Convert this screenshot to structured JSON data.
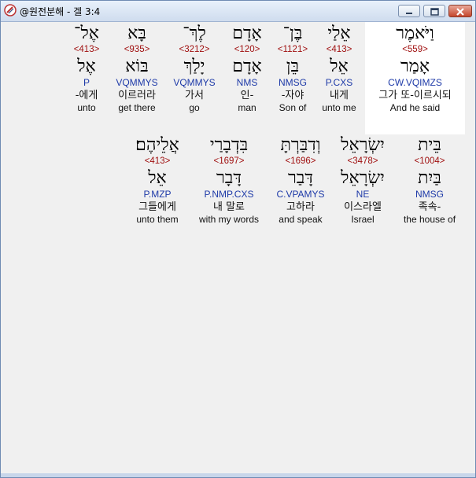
{
  "window": {
    "title": "@원전분해 - 겔 3:4",
    "icons": {
      "app": "bible-app-icon",
      "minimize": "minimize-icon",
      "maximize": "maximize-icon",
      "close": "close-icon"
    }
  },
  "rows": [
    [
      {
        "surface": "אֶל־",
        "strong": "<413>",
        "lemma": "אֶל",
        "parse": "P",
        "korean": "-에게",
        "english": "unto"
      },
      {
        "surface": "בָּא",
        "strong": "<935>",
        "lemma": "בּוֹא",
        "parse": "VQMMYS",
        "korean": "이르러라",
        "english": "get there"
      },
      {
        "surface": "לֶךְ־",
        "strong": "<3212>",
        "lemma": "יָלַךְ",
        "parse": "VQMMYS",
        "korean": "가서",
        "english": "go"
      },
      {
        "surface": "אָדָם",
        "strong": "<120>",
        "lemma": "אָדָם",
        "parse": "NMS",
        "korean": "인-",
        "english": "man"
      },
      {
        "surface": "בֶּן־",
        "strong": "<1121>",
        "lemma": "בֵּן",
        "parse": "NMSG",
        "korean": "-자야",
        "english": "Son of"
      },
      {
        "surface": "אֵלַי",
        "strong": "<413>",
        "lemma": "אֵל",
        "parse": "P.CXS",
        "korean": "내게",
        "english": "unto me"
      },
      {
        "surface": "וַיֹּאמֶר",
        "strong": "<559>",
        "lemma": "אָמַר",
        "parse": "CW.VQIMZS",
        "korean": "그가 또-이르시되",
        "english": "And he said",
        "highlighted": true
      }
    ],
    [
      {
        "surface": "אֲלֵיהֶם׃",
        "strong": "<413>",
        "lemma": "אֵל",
        "parse": "P.MZP",
        "korean": "그들에게",
        "english": "unto them"
      },
      {
        "surface": "בִּדְבָרַי",
        "strong": "<1697>",
        "lemma": "דָּבָר",
        "parse": "P.NMP.CXS",
        "korean": "내 말로",
        "english": "with my words"
      },
      {
        "surface": "וְדִבַּרְתָּ",
        "strong": "<1696>",
        "lemma": "דָּבַר",
        "parse": "C.VPAMYS",
        "korean": "고하라",
        "english": "and speak"
      },
      {
        "surface": "יִשְׂרָאֵל",
        "strong": "<3478>",
        "lemma": "יִשְׂרָאֵל",
        "parse": "NE",
        "korean": "이스라엘",
        "english": "Israel"
      },
      {
        "surface": "בֵּית",
        "strong": "<1004>",
        "lemma": "בַּיִת",
        "parse": "NMSG",
        "korean": "족속-",
        "english": "the house of"
      }
    ]
  ]
}
